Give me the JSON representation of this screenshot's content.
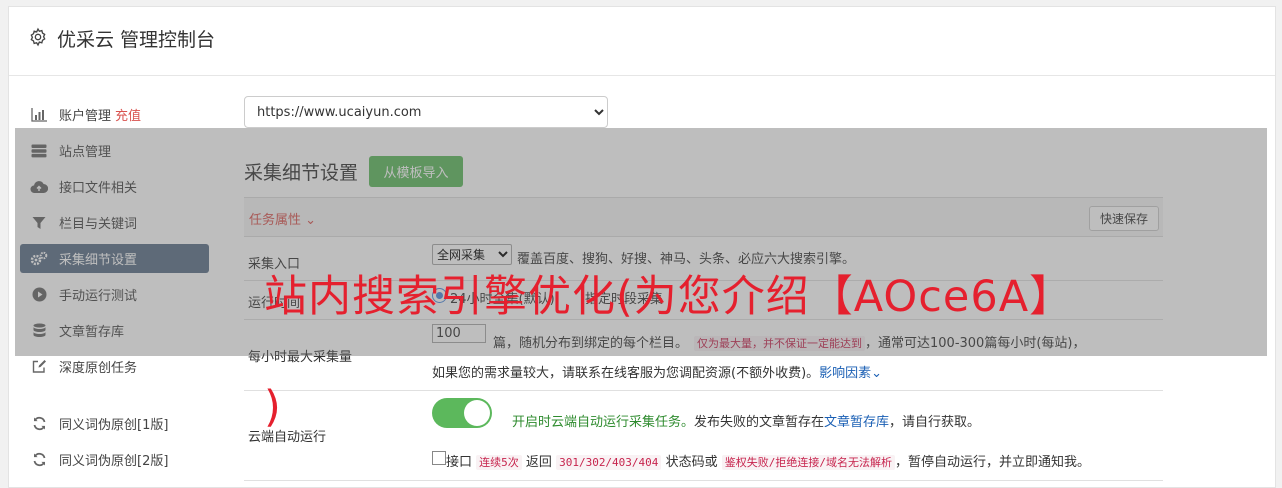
{
  "header": {
    "title": "优采云 管理控制台"
  },
  "sidebar": {
    "recharge_label": "充值",
    "items": [
      {
        "label": "账户管理",
        "icon": "bar-chart-icon"
      },
      {
        "label": "站点管理",
        "icon": "server-icon"
      },
      {
        "label": "接口文件相关",
        "icon": "cloud-upload-icon"
      },
      {
        "label": "栏目与关键词",
        "icon": "filter-icon"
      },
      {
        "label": "采集细节设置",
        "icon": "cogs-icon",
        "active": true
      },
      {
        "label": "手动运行测试",
        "icon": "play-circle-icon"
      },
      {
        "label": "文章暂存库",
        "icon": "database-icon"
      },
      {
        "label": "深度原创任务",
        "icon": "edit-icon"
      },
      {
        "label": "同义词伪原创[1版]",
        "icon": "refresh-icon"
      },
      {
        "label": "同义词伪原创[2版]",
        "icon": "refresh-icon"
      }
    ]
  },
  "site_select": {
    "value": "https://www.ucaiyun.com"
  },
  "section": {
    "title": "采集细节设置",
    "import_button": "从模板导入"
  },
  "attr_bar": {
    "label": "任务属性",
    "quick_save": "快速保存"
  },
  "rows": {
    "entry": {
      "label": "采集入口",
      "select_value": "全网采集",
      "desc": "覆盖百度、搜狗、好搜、神马、头条、必应六大搜索引擎。"
    },
    "runtime": {
      "label": "运行时间",
      "option_text": "24小时全集(默认)",
      "option_text2": "指定时段采集"
    },
    "max_per_hour": {
      "label": "每小时最大采集量",
      "value": "100",
      "text1": "篇，随机分布到绑定的每个栏目。",
      "note_code": "仅为最大量，并不保证一定能达到",
      "text2": "，通常可达100-300篇每小时(每站)，",
      "line2": "如果您的需求量较大，请联系在线客服为您调配资源(不额外收费)。",
      "link": "影响因素"
    },
    "cloud_auto": {
      "label": "云端自动运行",
      "toggle_on": true,
      "green_text": "开启时云端自动运行采集任务。",
      "text": "发布失败的文章暂存在",
      "link": "文章暂存库",
      "text_end": "，请自行获取。",
      "cb_text1": "接口",
      "cb_code1": "连续5次",
      "cb_text2": "返回",
      "cb_code2": "301/302/403/404",
      "cb_text3": "状态码或",
      "cb_code3": "鉴权失败/拒绝连接/域名无法解析",
      "cb_text4": "，暂停自动运行，并立即通知我。"
    }
  },
  "overlay": {
    "line1": "站内搜索引擎优化(为您介绍【AOce6A】",
    "line2": ")"
  },
  "colors": {
    "active_nav": "#5a6e87",
    "green": "#5cb85c",
    "red_text": "#d9534f",
    "overlay_red": "#e5202e"
  }
}
